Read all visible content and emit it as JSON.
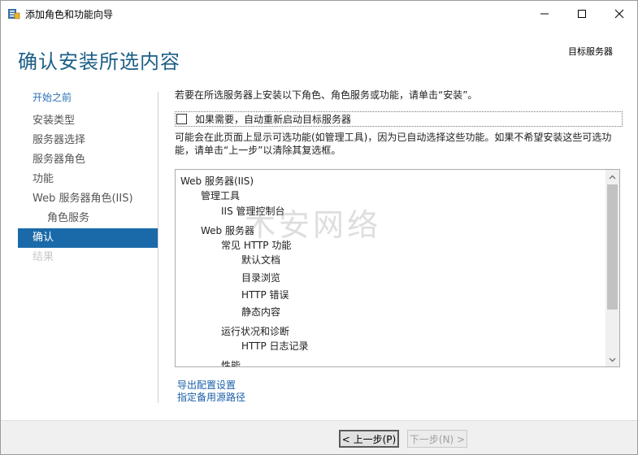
{
  "window": {
    "title": "添加角色和功能向导",
    "icon": "server-manager-icon"
  },
  "header": {
    "page_title": "确认安装所选内容",
    "target_server_label": "目标服务器"
  },
  "sidebar": {
    "items": [
      {
        "label": "开始之前",
        "state": "link"
      },
      {
        "label": "安装类型",
        "state": "normal"
      },
      {
        "label": "服务器选择",
        "state": "normal"
      },
      {
        "label": "服务器角色",
        "state": "normal"
      },
      {
        "label": "功能",
        "state": "normal"
      },
      {
        "label": "Web 服务器角色(IIS)",
        "state": "normal"
      },
      {
        "label": "角色服务",
        "state": "sub"
      },
      {
        "label": "确认",
        "state": "active"
      },
      {
        "label": "结果",
        "state": "disabled"
      }
    ]
  },
  "content": {
    "instruction": "若要在所选服务器上安装以下角色、角色服务或功能，请单击“安装”。",
    "restart_label": "如果需要，自动重新启动目标服务器",
    "restart_checked": false,
    "info_text": "可能会在此页面上显示可选功能(如管理工具)，因为已自动选择这些功能。如果不希望安装这些可选功能，请单击“上一步”以清除其复选框。",
    "features": [
      {
        "label": "Web 服务器(IIS)",
        "level": 0
      },
      {
        "label": "管理工具",
        "level": 1
      },
      {
        "label": "IIS 管理控制台",
        "level": 2
      },
      {
        "label": "Web 服务器",
        "level": 1
      },
      {
        "label": "常见 HTTP 功能",
        "level": 2
      },
      {
        "label": "默认文档",
        "level": 3
      },
      {
        "label": "目录浏览",
        "level": 3
      },
      {
        "label": "HTTP 错误",
        "level": 3
      },
      {
        "label": "静态内容",
        "level": 3
      },
      {
        "label": "运行状况和诊断",
        "level": 2
      },
      {
        "label": "HTTP 日志记录",
        "level": 3
      },
      {
        "label": "性能",
        "level": 2
      }
    ]
  },
  "links": {
    "export": "导出配置设置",
    "alternate_source": "指定备用源路径"
  },
  "footer": {
    "prev_label": "< 上一步(P)",
    "next_label": "下一步(N) >"
  },
  "watermark": "木安网络",
  "colors": {
    "title": "#1d5f86",
    "active": "#1a6aa9",
    "link": "#2a6fb8"
  }
}
